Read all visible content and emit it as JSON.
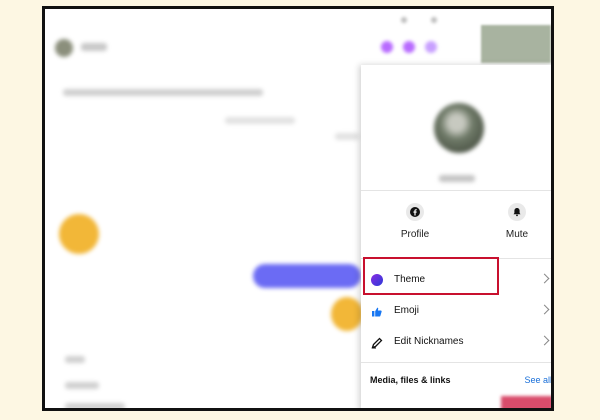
{
  "panel": {
    "actions": [
      {
        "label": "Profile",
        "icon": "facebook-icon"
      },
      {
        "label": "Mute",
        "icon": "bell-icon"
      }
    ],
    "menu": [
      {
        "label": "Theme",
        "icon": "theme-color-icon"
      },
      {
        "label": "Emoji",
        "icon": "thumbs-up-icon"
      },
      {
        "label": "Edit Nicknames",
        "icon": "pencil-icon"
      }
    ],
    "section": {
      "label": "Media, files & links",
      "see_all": "See all"
    }
  },
  "colors": {
    "highlight": "#c8102e",
    "link": "#1a6fd8",
    "emoji_icon": "#1877f2",
    "theme_gradient_start": "#8a2be2",
    "theme_gradient_end": "#2b3ad8"
  }
}
